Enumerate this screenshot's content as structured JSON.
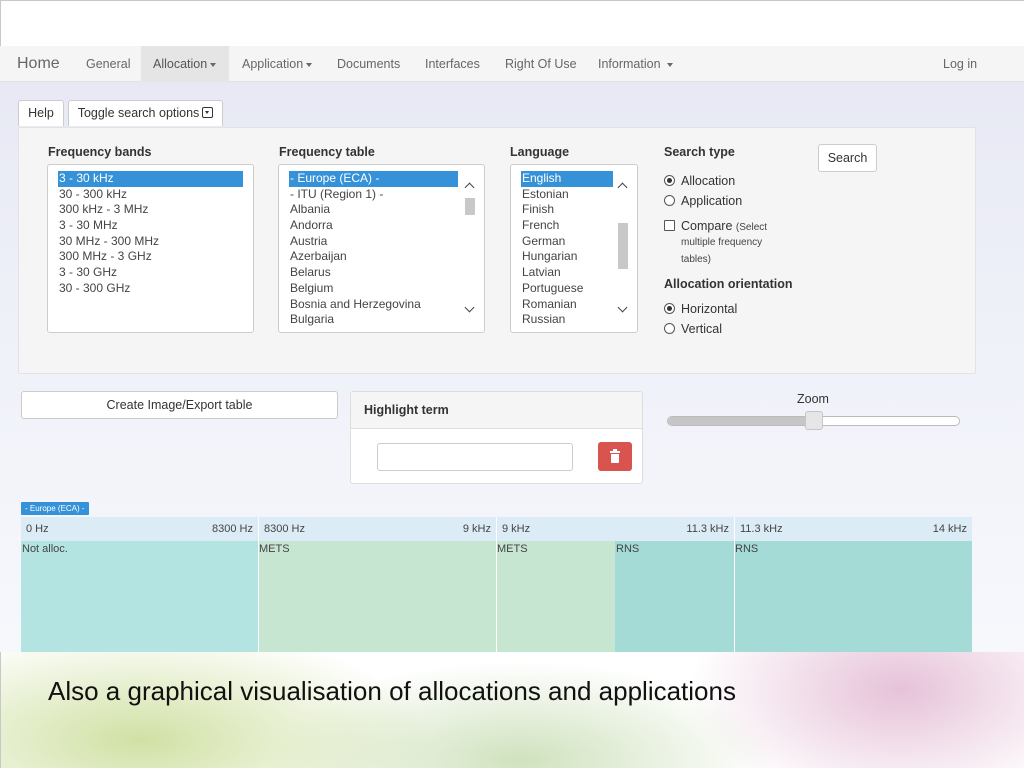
{
  "navbar": {
    "brand": "Home",
    "items": [
      "General",
      "Allocation",
      "Application",
      "Documents",
      "Interfaces",
      "Right Of Use",
      "Information"
    ],
    "login": "Log in"
  },
  "toolbar": {
    "help": "Help",
    "toggle": "Toggle search options"
  },
  "search": {
    "bands_label": "Frequency bands",
    "bands": [
      "3 - 30 kHz",
      "30 - 300 kHz",
      "300 kHz - 3 MHz",
      "3 - 30 MHz",
      "30 MHz - 300 MHz",
      "300 MHz - 3 GHz",
      "3 - 30 GHz",
      "30 - 300 GHz"
    ],
    "table_label": "Frequency table",
    "tables": [
      "- Europe (ECA) -",
      "- ITU (Region 1) -",
      "Albania",
      "Andorra",
      "Austria",
      "Azerbaijan",
      "Belarus",
      "Belgium",
      "Bosnia and Herzegovina",
      "Bulgaria"
    ],
    "language_label": "Language",
    "languages": [
      "English",
      "Estonian",
      "Finish",
      "French",
      "German",
      "Hungarian",
      "Latvian",
      "Portuguese",
      "Romanian",
      "Russian"
    ],
    "type_label": "Search type",
    "type_allocation": "Allocation",
    "type_application": "Application",
    "compare": "Compare",
    "compare_note": "(Select",
    "compare_note2": "multiple frequency",
    "compare_note3": "tables)",
    "orientation_label": "Allocation orientation",
    "horizontal": "Horizontal",
    "vertical": "Vertical",
    "search_button": "Search"
  },
  "actions": {
    "export": "Create Image/Export table",
    "highlight_title": "Highlight term",
    "highlight_value": "",
    "zoom_label": "Zoom",
    "zoom_level": 0.5
  },
  "chart": {
    "badge": "- Europe (ECA) -",
    "ranges": [
      {
        "lo": "0 Hz",
        "hi": "8300 Hz"
      },
      {
        "lo": "8300 Hz",
        "hi": "9 kHz"
      },
      {
        "lo": "9 kHz",
        "hi": "11.3 kHz"
      },
      {
        "lo": "11.3 kHz",
        "hi": "14 kHz"
      }
    ],
    "blocks": [
      "Not alloc.",
      "METS",
      "METS",
      "RNS",
      "RNS"
    ],
    "colors": {
      "not_alloc": "#b3e4e2",
      "mets": "#c7e6d2",
      "rns": "#a5dbd7",
      "header": "#dcecf6"
    }
  },
  "caption": "Also a graphical visualisation of allocations and applications"
}
